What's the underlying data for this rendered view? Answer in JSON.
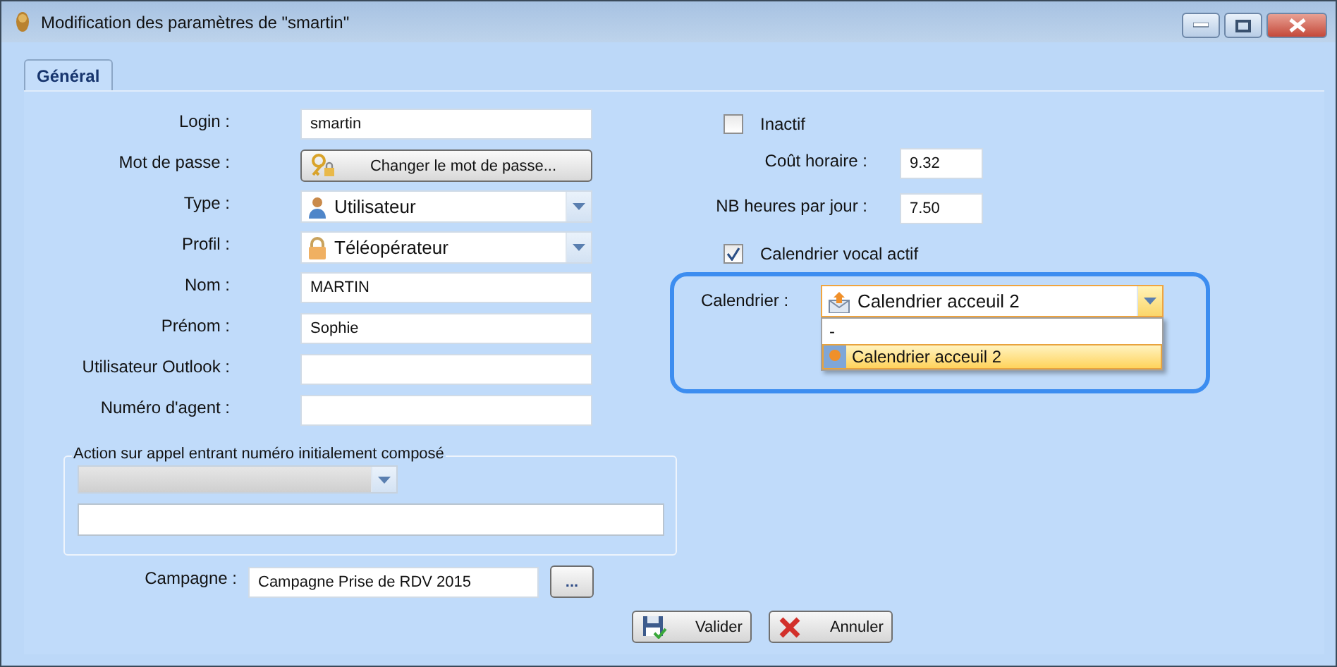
{
  "window": {
    "title": "Modification des paramètres de \"smartin\""
  },
  "tabs": [
    {
      "label": "Général",
      "selected": true
    }
  ],
  "left_fields": [
    {
      "kind": "text",
      "label": "Login :",
      "value": "smartin"
    },
    {
      "kind": "button",
      "label": "Mot de passe :",
      "button": "Changer le mot de passe..."
    },
    {
      "kind": "combo",
      "label": "Type :",
      "value": "Utilisateur"
    },
    {
      "kind": "combo",
      "label": "Profil :",
      "value": "Téléopérateur"
    },
    {
      "kind": "text",
      "label": "Nom :",
      "value": "MARTIN"
    },
    {
      "kind": "text",
      "label": "Prénom :",
      "value": "Sophie"
    },
    {
      "kind": "text",
      "label": "Utilisateur Outlook :"
    },
    {
      "kind": "text",
      "label": "Numéro d'agent :"
    }
  ],
  "incoming_call_group": {
    "title": "Action sur appel entrant numéro initialement composé"
  },
  "campaign": {
    "label": "Campagne :",
    "value": "Campagne Prise de RDV 2015",
    "button": "..."
  },
  "right_fields": [
    {
      "kind": "checkbox",
      "label": "Inactif",
      "checked": false
    },
    {
      "kind": "text",
      "label": "Coût horaire :",
      "value": "9.32"
    },
    {
      "kind": "text",
      "label": "NB heures par jour :",
      "value": "7.50"
    },
    {
      "kind": "checkbox",
      "label": "Calendrier vocal actif",
      "checked": true
    }
  ],
  "calendar": {
    "label": "Calendrier :",
    "value": "Calendrier acceuil 2",
    "expanded": true,
    "options": [
      {
        "label": "-",
        "selected": false
      },
      {
        "label": "Calendrier acceuil 2",
        "selected": true
      }
    ]
  },
  "buttons": [
    {
      "kind": "save",
      "label": "Valider"
    },
    {
      "kind": "cancel",
      "label": "Annuler"
    }
  ]
}
